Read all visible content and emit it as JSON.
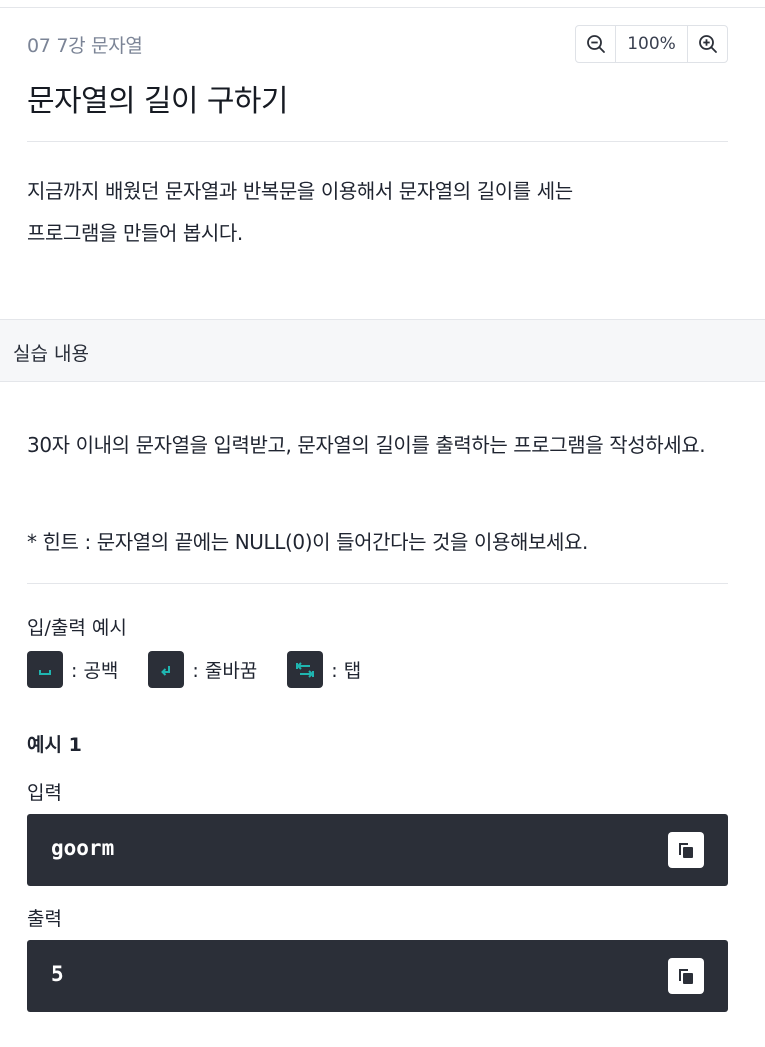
{
  "header": {
    "breadcrumb": "07 7강 문자열",
    "title": "문자열의 길이 구하기"
  },
  "zoom": {
    "value": "100%"
  },
  "description": {
    "line1": "지금까지 배웠던 문자열과 반복문을 이용해서 문자열의 길이를 세는",
    "line2": "프로그램을 만들어 봅시다."
  },
  "section": {
    "label": "실습 내용"
  },
  "task": {
    "text": "30자 이내의 문자열을 입력받고, 문자열의 길이를 출력하는 프로그램을 작성하세요.",
    "hint": "* 힌트 : 문자열의 끝에는 NULL(0)이 들어간다는 것을 이용해보세요."
  },
  "io": {
    "title": "입/출력 예시",
    "legend": [
      {
        "icon": "space-icon",
        "label": ": 공백"
      },
      {
        "icon": "newline-icon",
        "label": ": 줄바꿈"
      },
      {
        "icon": "tab-icon",
        "label": ": 탭"
      }
    ]
  },
  "examples": [
    {
      "title": "예시 1",
      "input_label": "입력",
      "input": "goorm",
      "output_label": "출력",
      "output": "5"
    }
  ],
  "colors": {
    "code_bg": "#2b2f38",
    "legend_glyph": "#1fb5b0",
    "muted_text": "#7b8496"
  }
}
